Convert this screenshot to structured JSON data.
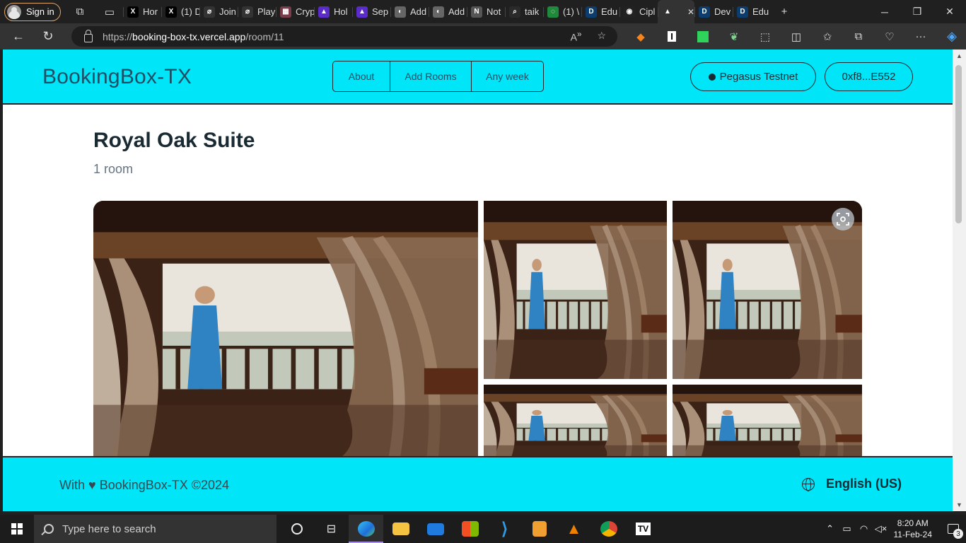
{
  "browser": {
    "signin_label": "Sign in",
    "tabs": [
      {
        "label": "Hor",
        "icon": "x-icon",
        "color": "#000000"
      },
      {
        "label": "(1) D",
        "icon": "x-icon",
        "color": "#000000"
      },
      {
        "label": "Join",
        "icon": "zora-icon",
        "color": "#333333"
      },
      {
        "label": "Play",
        "icon": "zora-icon",
        "color": "#333333"
      },
      {
        "label": "Cryp",
        "icon": "grid-icon",
        "color": "#7a3b4a"
      },
      {
        "label": "Hol",
        "icon": "triangle-icon",
        "color": "#5b2cc9"
      },
      {
        "label": "Sep",
        "icon": "triangle-icon",
        "color": "#5b2cc9"
      },
      {
        "label": "Add",
        "icon": "chain-icon",
        "color": "#666666"
      },
      {
        "label": "Add",
        "icon": "chain-icon",
        "color": "#666666"
      },
      {
        "label": "Not",
        "icon": "notion-icon",
        "color": "#555555"
      },
      {
        "label": "taik",
        "icon": "search-icon",
        "color": "#2a2a2a"
      },
      {
        "label": "(1) \\",
        "icon": "whatsapp-icon",
        "color": "#1f8a3c"
      },
      {
        "label": "Edu",
        "icon": "d-icon",
        "color": "#0b3d6e"
      },
      {
        "label": "Cipl",
        "icon": "github-icon",
        "color": "#222222"
      },
      {
        "label": "",
        "icon": "vercel-icon",
        "color": "#333333",
        "active": true
      },
      {
        "label": "Dev",
        "icon": "d-icon",
        "color": "#0b3d6e"
      },
      {
        "label": "Edu",
        "icon": "d-icon",
        "color": "#0b3d6e"
      }
    ],
    "url_scheme": "https://",
    "url_host": "booking-box-tx.vercel.app",
    "url_path": "/room/11"
  },
  "header": {
    "brand": "BookingBox-TX",
    "nav": [
      "About",
      "Add Rooms",
      "Any week"
    ],
    "network": "Pegasus Testnet",
    "wallet": "0xf8...E552"
  },
  "room": {
    "title": "Royal Oak Suite",
    "subtitle": "1 room"
  },
  "footer": {
    "left": "With ♥ BookingBox-TX ©2024",
    "language": "English (US)"
  },
  "taskbar": {
    "search_placeholder": "Type here to search",
    "time": "8:20 AM",
    "date": "11-Feb-24",
    "notifications": "3"
  },
  "colors": {
    "accent": "#00e5f7",
    "text_dark": "#1a2a33"
  }
}
